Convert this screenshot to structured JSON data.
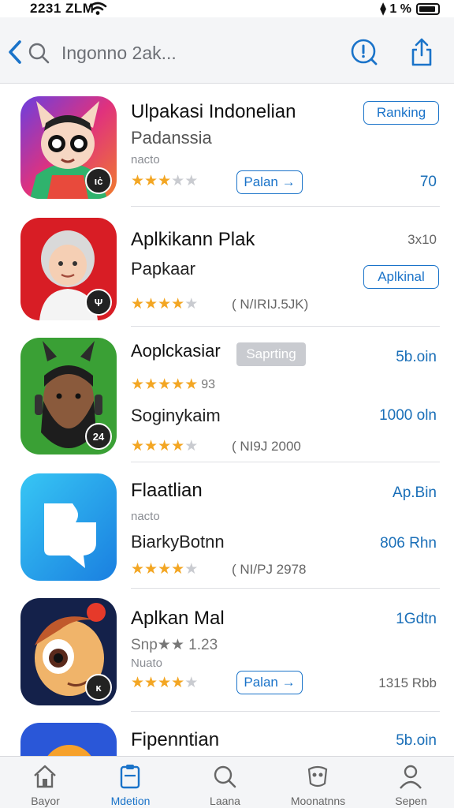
{
  "status_bar": {
    "time": "2231 ZLM",
    "right_text": "⧫ 1 %"
  },
  "nav": {
    "title": "Ingonno 2ak..."
  },
  "apps": [
    {
      "title": "Ulpakasi Indonelian",
      "subtitle": "Padanssia",
      "caption": "nacto",
      "rating": 3,
      "button": "Palan →",
      "tag": "Ranking",
      "value": "70",
      "badge": "ιċ",
      "icon": "cat-icon"
    },
    {
      "title": "Aplkikann Plak",
      "subtitle": "Papkaar",
      "rating": 4,
      "meta": "( N/IRIJ.5JK)",
      "tag": "Aplkinal",
      "value": "3x10",
      "badge": "Ψ",
      "icon": "woman-icon"
    },
    {
      "title": "Aoplckasiar",
      "tag_gray": "Saprting",
      "rating": 5,
      "rating_suffix": "93",
      "subtitle": "Soginykaim",
      "rating2": 4,
      "meta": "( NI9J 2000",
      "value": "5b.oin",
      "value2": "1000 oln",
      "badge": "24",
      "icon": "bearded-man-icon"
    },
    {
      "title": "Flaatlian",
      "caption": "nacto",
      "subtitle": "BiarkyBotnn",
      "rating": 4,
      "meta": "( NI/PJ 2978",
      "value": "Ap.Bin",
      "value2": "806 Rhn",
      "icon": "chat-bubble-icon"
    },
    {
      "title": "Aplkan Mal",
      "subtitle": "Snp★★ 1.23",
      "caption": "Nuato",
      "rating": 4,
      "button": "Palan →",
      "value": "1Gdtn",
      "value2": "1315 Rbb",
      "badge": "ĸ",
      "icon": "cartoon-face-icon"
    },
    {
      "title": "Fipenntian",
      "value": "5b.oin",
      "icon": "emoji-icon"
    }
  ],
  "tabs": [
    {
      "label": "Bayor",
      "icon": "home-icon",
      "active": false
    },
    {
      "label": "Mdetion",
      "icon": "clipboard-icon",
      "active": true
    },
    {
      "label": "Laana",
      "icon": "search-icon",
      "active": false
    },
    {
      "label": "Moonatnns",
      "icon": "games-icon",
      "active": false
    },
    {
      "label": "Sepen",
      "icon": "person-icon",
      "active": false
    }
  ],
  "colors": {
    "accent": "#1a73c9",
    "star": "#f3a623",
    "star_off": "#c9cbd0"
  }
}
